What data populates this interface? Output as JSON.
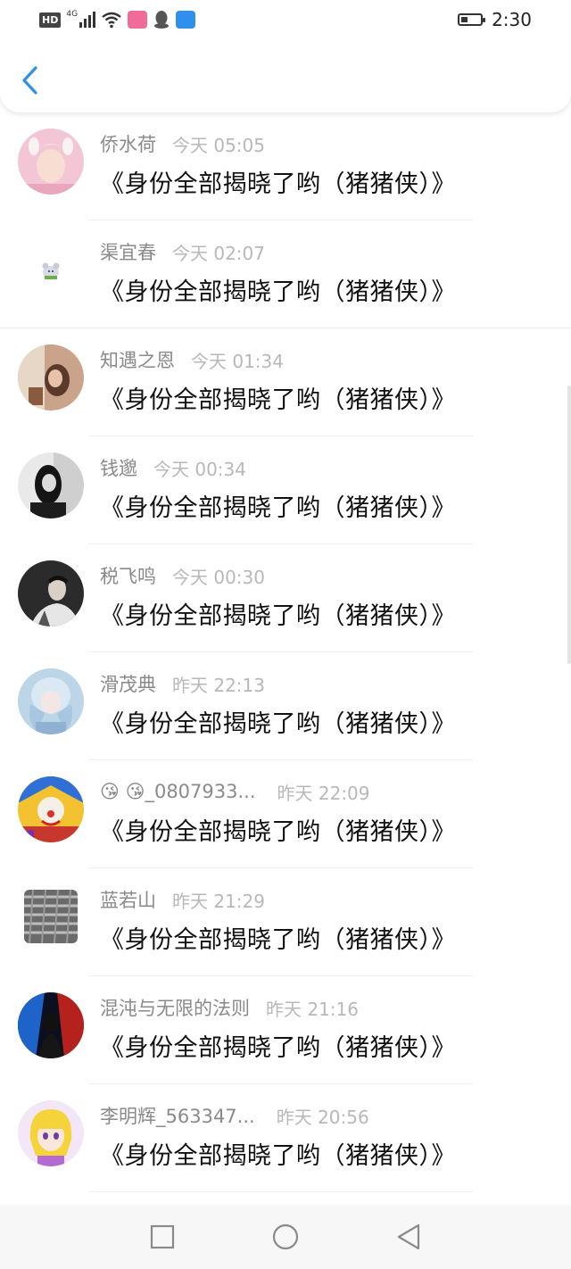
{
  "status_bar": {
    "hd": "HD",
    "network": "4G",
    "time": "2:30",
    "battery_level": 0.35,
    "app_icons": [
      "bilibili-app-icon",
      "qq-app-icon",
      "store-app-icon"
    ]
  },
  "header": {
    "back_icon": "chevron-left-icon",
    "accent_color": "#2e90e8"
  },
  "messages": [
    {
      "name": "侨水荷",
      "time": "今天 05:05",
      "text": "《身份全部揭晓了哟（猪猪侠）》"
    },
    {
      "name": "渠宜春",
      "time": "今天 02:07",
      "text": "《身份全部揭晓了哟（猪猪侠）》"
    },
    {
      "name": "知遇之恩",
      "time": "今天 01:34",
      "text": "《身份全部揭晓了哟（猪猪侠）》"
    },
    {
      "name": "钱邈",
      "time": "今天 00:34",
      "text": "《身份全部揭晓了哟（猪猪侠）》"
    },
    {
      "name": "税飞鸣",
      "time": "今天 00:30",
      "text": "《身份全部揭晓了哟（猪猪侠）》"
    },
    {
      "name": "滑茂典",
      "time": "昨天 22:13",
      "text": "《身份全部揭晓了哟（猪猪侠）》"
    },
    {
      "name": "😘 😘_0807933...",
      "time": "昨天 22:09",
      "text": "《身份全部揭晓了哟（猪猪侠）》"
    },
    {
      "name": "蓝若山",
      "time": "昨天 21:29",
      "text": "《身份全部揭晓了哟（猪猪侠）》"
    },
    {
      "name": "混沌与无限的法则",
      "time": "昨天 21:16",
      "text": "《身份全部揭晓了哟（猪猪侠）》"
    },
    {
      "name": "李明辉_563347...",
      "time": "昨天 20:56",
      "text": "《身份全部揭晓了哟（猪猪侠）》"
    }
  ],
  "nav_bar": {
    "icons": [
      "recent-apps-icon",
      "home-icon",
      "back-triangle-icon"
    ]
  }
}
